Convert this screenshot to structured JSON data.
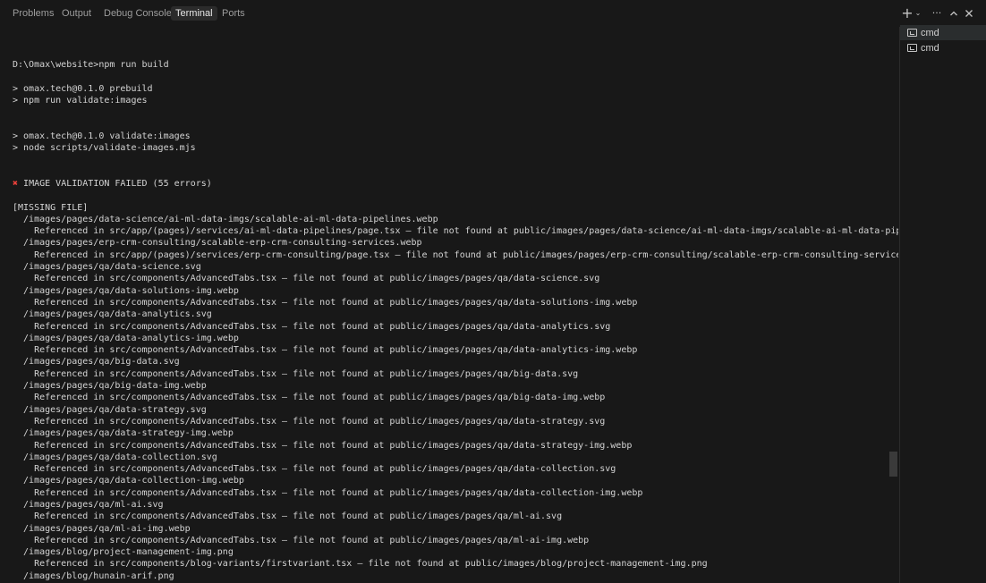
{
  "tabs": [
    "Problems",
    "Output",
    "Debug Console",
    "Terminal",
    "Ports"
  ],
  "active_tab": "Terminal",
  "toolbar": {
    "new_terminal_icon": "plus-icon",
    "dropdown_icon": "chevron-down-icon",
    "more_icon": "ellipsis-icon",
    "maximize_icon": "chevron-up-icon",
    "close_icon": "close-icon"
  },
  "terminals": [
    {
      "label": "cmd",
      "icon": "terminal-icon"
    },
    {
      "label": "cmd",
      "icon": "terminal-icon"
    }
  ],
  "error_mark_color": "#e8403a",
  "output": {
    "error_header": "IMAGE VALIDATION FAILED (55 errors)",
    "lines": [
      "D:\\Omax\\website>npm run build",
      "",
      "> omax.tech@0.1.0 prebuild",
      "> npm run validate:images",
      "",
      "",
      "> omax.tech@0.1.0 validate:images",
      "> node scripts/validate-images.mjs",
      "",
      "",
      "",
      "",
      "[MISSING FILE]",
      "  /images/pages/data-science/ai-ml-data-imgs/scalable-ai-ml-data-pipelines.webp",
      "    Referenced in src/app/(pages)/services/ai-ml-data-pipelines/page.tsx – file not found at public/images/pages/data-science/ai-ml-data-imgs/scalable-ai-ml-data-pipelines.webp",
      "  /images/pages/erp-crm-consulting/scalable-erp-crm-consulting-services.webp",
      "    Referenced in src/app/(pages)/services/erp-crm-consulting/page.tsx – file not found at public/images/pages/erp-crm-consulting/scalable-erp-crm-consulting-services.webp",
      "  /images/pages/qa/data-science.svg",
      "    Referenced in src/components/AdvancedTabs.tsx – file not found at public/images/pages/qa/data-science.svg",
      "  /images/pages/qa/data-solutions-img.webp",
      "    Referenced in src/components/AdvancedTabs.tsx – file not found at public/images/pages/qa/data-solutions-img.webp",
      "  /images/pages/qa/data-analytics.svg",
      "    Referenced in src/components/AdvancedTabs.tsx – file not found at public/images/pages/qa/data-analytics.svg",
      "  /images/pages/qa/data-analytics-img.webp",
      "    Referenced in src/components/AdvancedTabs.tsx – file not found at public/images/pages/qa/data-analytics-img.webp",
      "  /images/pages/qa/big-data.svg",
      "    Referenced in src/components/AdvancedTabs.tsx – file not found at public/images/pages/qa/big-data.svg",
      "  /images/pages/qa/big-data-img.webp",
      "    Referenced in src/components/AdvancedTabs.tsx – file not found at public/images/pages/qa/big-data-img.webp",
      "  /images/pages/qa/data-strategy.svg",
      "    Referenced in src/components/AdvancedTabs.tsx – file not found at public/images/pages/qa/data-strategy.svg",
      "  /images/pages/qa/data-strategy-img.webp",
      "    Referenced in src/components/AdvancedTabs.tsx – file not found at public/images/pages/qa/data-strategy-img.webp",
      "  /images/pages/qa/data-collection.svg",
      "    Referenced in src/components/AdvancedTabs.tsx – file not found at public/images/pages/qa/data-collection.svg",
      "  /images/pages/qa/data-collection-img.webp",
      "    Referenced in src/components/AdvancedTabs.tsx – file not found at public/images/pages/qa/data-collection-img.webp",
      "  /images/pages/qa/ml-ai.svg",
      "    Referenced in src/components/AdvancedTabs.tsx – file not found at public/images/pages/qa/ml-ai.svg",
      "  /images/pages/qa/ml-ai-img.webp",
      "    Referenced in src/components/AdvancedTabs.tsx – file not found at public/images/pages/qa/ml-ai-img.webp",
      "  /images/blog/project-management-img.png",
      "    Referenced in src/components/blog-variants/firstvariant.tsx – file not found at public/images/blog/project-management-img.png",
      "  /images/blog/hunain-arif.png"
    ]
  }
}
